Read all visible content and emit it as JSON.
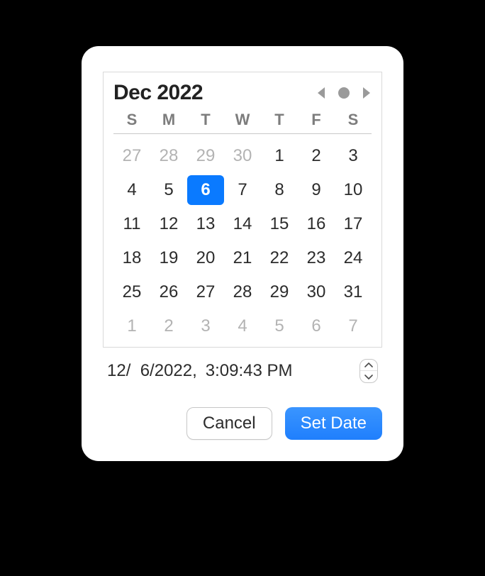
{
  "calendar": {
    "month_label": "Dec 2022",
    "dow": [
      "S",
      "M",
      "T",
      "W",
      "T",
      "F",
      "S"
    ],
    "cells": [
      {
        "d": "27",
        "out": true
      },
      {
        "d": "28",
        "out": true
      },
      {
        "d": "29",
        "out": true
      },
      {
        "d": "30",
        "out": true
      },
      {
        "d": "1"
      },
      {
        "d": "2"
      },
      {
        "d": "3"
      },
      {
        "d": "4"
      },
      {
        "d": "5"
      },
      {
        "d": "6",
        "sel": true
      },
      {
        "d": "7"
      },
      {
        "d": "8"
      },
      {
        "d": "9"
      },
      {
        "d": "10"
      },
      {
        "d": "11"
      },
      {
        "d": "12"
      },
      {
        "d": "13"
      },
      {
        "d": "14"
      },
      {
        "d": "15"
      },
      {
        "d": "16"
      },
      {
        "d": "17"
      },
      {
        "d": "18"
      },
      {
        "d": "19"
      },
      {
        "d": "20"
      },
      {
        "d": "21"
      },
      {
        "d": "22"
      },
      {
        "d": "23"
      },
      {
        "d": "24"
      },
      {
        "d": "25"
      },
      {
        "d": "26"
      },
      {
        "d": "27"
      },
      {
        "d": "28"
      },
      {
        "d": "29"
      },
      {
        "d": "30"
      },
      {
        "d": "31"
      },
      {
        "d": "1",
        "out": true
      },
      {
        "d": "2",
        "out": true
      },
      {
        "d": "3",
        "out": true
      },
      {
        "d": "4",
        "out": true
      },
      {
        "d": "5",
        "out": true
      },
      {
        "d": "6",
        "out": true
      },
      {
        "d": "7",
        "out": true
      }
    ]
  },
  "datetime": {
    "date": "12/  6/2022,",
    "time": "3:09:43 PM"
  },
  "buttons": {
    "cancel": "Cancel",
    "set": "Set Date"
  }
}
